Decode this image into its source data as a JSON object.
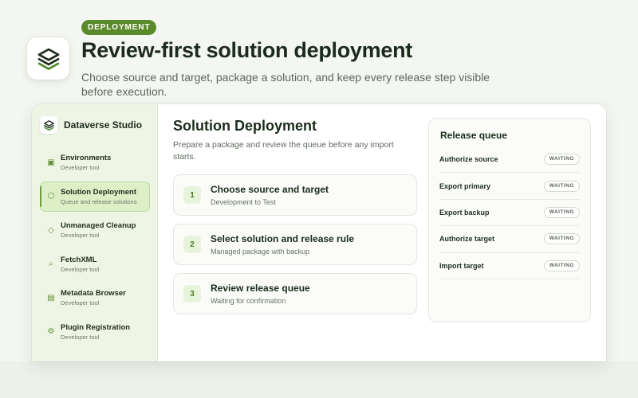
{
  "hero": {
    "badge": "DEPLOYMENT",
    "title": "Review-first solution deployment",
    "subtitle": "Choose source and target, package a solution, and keep every release step visible before execution.",
    "logo_icon": "stack-layers-icon"
  },
  "sidebar": {
    "brand_name": "Dataverse Studio",
    "brand_icon": "stack-layers-icon",
    "items": [
      {
        "label": "Environments",
        "sub": "Developer tool",
        "icon": "square-icon",
        "glyph": "▣",
        "active": false
      },
      {
        "label": "Solution Deployment",
        "sub": "Queue and release solutions",
        "icon": "hexagon-icon",
        "glyph": "⬡",
        "active": true
      },
      {
        "label": "Unmanaged Cleanup",
        "sub": "Developer tool",
        "icon": "diamond-icon",
        "glyph": "◇",
        "active": false
      },
      {
        "label": "FetchXML",
        "sub": "Developer tool",
        "icon": "search-icon",
        "glyph": "⌕",
        "active": false
      },
      {
        "label": "Metadata Browser",
        "sub": "Developer tool",
        "icon": "table-icon",
        "glyph": "▤",
        "active": false
      },
      {
        "label": "Plugin Registration",
        "sub": "Developer tool",
        "icon": "gear-icon",
        "glyph": "⚙",
        "active": false
      }
    ]
  },
  "main": {
    "title": "Solution Deployment",
    "description": "Prepare a package and review the queue before any import starts.",
    "steps": [
      {
        "number": "1",
        "title": "Choose source and target",
        "sub": "Development to Test"
      },
      {
        "number": "2",
        "title": "Select solution and release rule",
        "sub": "Managed package with backup"
      },
      {
        "number": "3",
        "title": "Review release queue",
        "sub": "Waiting for confirmation"
      }
    ]
  },
  "queue": {
    "title": "Release queue",
    "items": [
      {
        "label": "Authorize source",
        "status": "WAITING"
      },
      {
        "label": "Export primary",
        "status": "WAITING"
      },
      {
        "label": "Export backup",
        "status": "WAITING"
      },
      {
        "label": "Authorize target",
        "status": "WAITING"
      },
      {
        "label": "Import target",
        "status": "WAITING"
      }
    ]
  },
  "colors": {
    "accent": "#5b8a2a",
    "background": "#f4f6f1",
    "sidebar_bg": "#eef5e5",
    "active_item_bg": "#dcefc7"
  }
}
